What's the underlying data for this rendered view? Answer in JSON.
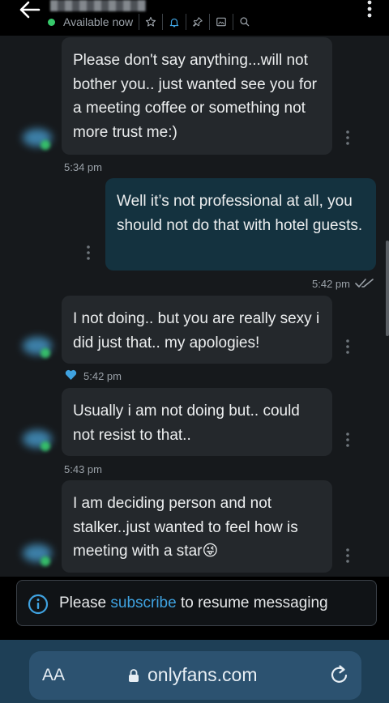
{
  "header": {
    "status": "Available now",
    "icons": [
      "star-icon",
      "bell-icon",
      "pin-icon",
      "image-icon",
      "search-icon"
    ]
  },
  "messages": [
    {
      "direction": "in",
      "text": "Please don't say anything...will not bother you.. just wanted see you for a meeting coffee or something not more trust me:)",
      "time": "5:34 pm"
    },
    {
      "direction": "out",
      "text": "Well it’s not professional at all, you should not do that with hotel guests.",
      "time": "5:42 pm",
      "read": true
    },
    {
      "direction": "in",
      "text": "I not doing.. but you are really sexy i did just that.. my apologies!",
      "time": "5:42 pm",
      "liked": true
    },
    {
      "direction": "in",
      "text": "Usually i am not doing but.. could not resist to that..",
      "time": "5:43 pm"
    },
    {
      "direction": "in",
      "text": "I am deciding person and not stalker..just wanted to feel how is meeting with a star",
      "emoji": "😜"
    }
  ],
  "notice": {
    "before": "Please ",
    "link": "subscribe",
    "after": " to resume messaging"
  },
  "browser": {
    "text_size_label": "AA",
    "url": "onlyfans.com"
  },
  "colors": {
    "accent": "#3fa2e0",
    "online": "#37c96b",
    "outgoing_bubble": "#14323f",
    "incoming_bubble": "#24282c"
  }
}
